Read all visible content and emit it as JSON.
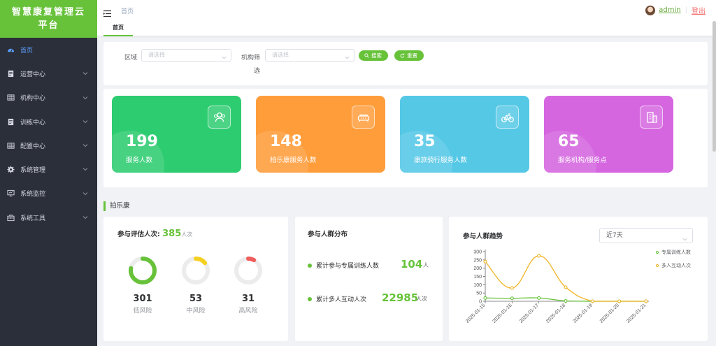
{
  "app": {
    "title": "智慧康复管理云平台"
  },
  "sidebar": {
    "items": [
      {
        "label": "首页",
        "icon": "dashboard-icon"
      },
      {
        "label": "运营中心",
        "icon": "document-icon"
      },
      {
        "label": "机构中心",
        "icon": "grid-icon"
      },
      {
        "label": "训练中心",
        "icon": "document-icon"
      },
      {
        "label": "配置中心",
        "icon": "grid-icon"
      },
      {
        "label": "系统管理",
        "icon": "gear-icon"
      },
      {
        "label": "系统监控",
        "icon": "monitor-icon"
      },
      {
        "label": "系统工具",
        "icon": "toolbox-icon"
      }
    ]
  },
  "header": {
    "breadcrumb": "首页",
    "user": "admin",
    "separator": "|",
    "logout": "登出"
  },
  "tags": {
    "active": "首页"
  },
  "filters": {
    "region_label": "区域",
    "region_placeholder": "请选择",
    "org_label_1": "机构筛",
    "org_label_2": "选",
    "org_placeholder": "请选择",
    "search_label": "搜索",
    "reset_label": "重置"
  },
  "stats": [
    {
      "value": "199",
      "label": "服务人数",
      "color": "#2ecc71",
      "icon": "users-icon"
    },
    {
      "value": "148",
      "label": "拍乐康服务人数",
      "color": "#ff9d3b",
      "icon": "sofa-icon"
    },
    {
      "value": "35",
      "label": "康旅骑行服务人数",
      "color": "#55c8e6",
      "icon": "bicycle-icon"
    },
    {
      "value": "65",
      "label": "服务机构/服务点",
      "color": "#d566e0",
      "icon": "building-icon"
    }
  ],
  "section": {
    "title": "拍乐康"
  },
  "evaluation": {
    "title": "参与评估人次:",
    "total": "385",
    "unit": "人次",
    "items": [
      {
        "value": "301",
        "label": "低风险",
        "color": "#67c23a",
        "fraction": 0.78
      },
      {
        "value": "53",
        "label": "中风险",
        "color": "#f5d020",
        "fraction": 0.14
      },
      {
        "value": "31",
        "label": "高风险",
        "color": "#f05c5c",
        "fraction": 0.08
      }
    ]
  },
  "distribution": {
    "title": "参与人群分布",
    "items": [
      {
        "label": "累计参与专属训练人数",
        "value": "104",
        "unit": "人"
      },
      {
        "label": "累计多人互动人次",
        "value": "22985",
        "unit": "人次"
      }
    ]
  },
  "trend": {
    "title": "参与人群趋势",
    "range": "近7天"
  },
  "chart_data": {
    "type": "line",
    "x": [
      "2025-01-15",
      "2025-01-16",
      "2025-01-17",
      "2025-01-18",
      "2025-01-19",
      "2025-01-20",
      "2025-01-21"
    ],
    "yticks": [
      "0",
      "50",
      "100",
      "150",
      "200",
      "250",
      "300"
    ],
    "ylim": [
      0,
      300
    ],
    "grid": false,
    "legend": "right",
    "series": [
      {
        "name": "专属训练人数",
        "color": "#67c23a",
        "values": [
          20,
          18,
          20,
          2,
          0,
          0,
          0
        ]
      },
      {
        "name": "多人互动人次",
        "color": "#f0b323",
        "values": [
          240,
          80,
          275,
          85,
          0,
          0,
          0
        ]
      }
    ]
  }
}
